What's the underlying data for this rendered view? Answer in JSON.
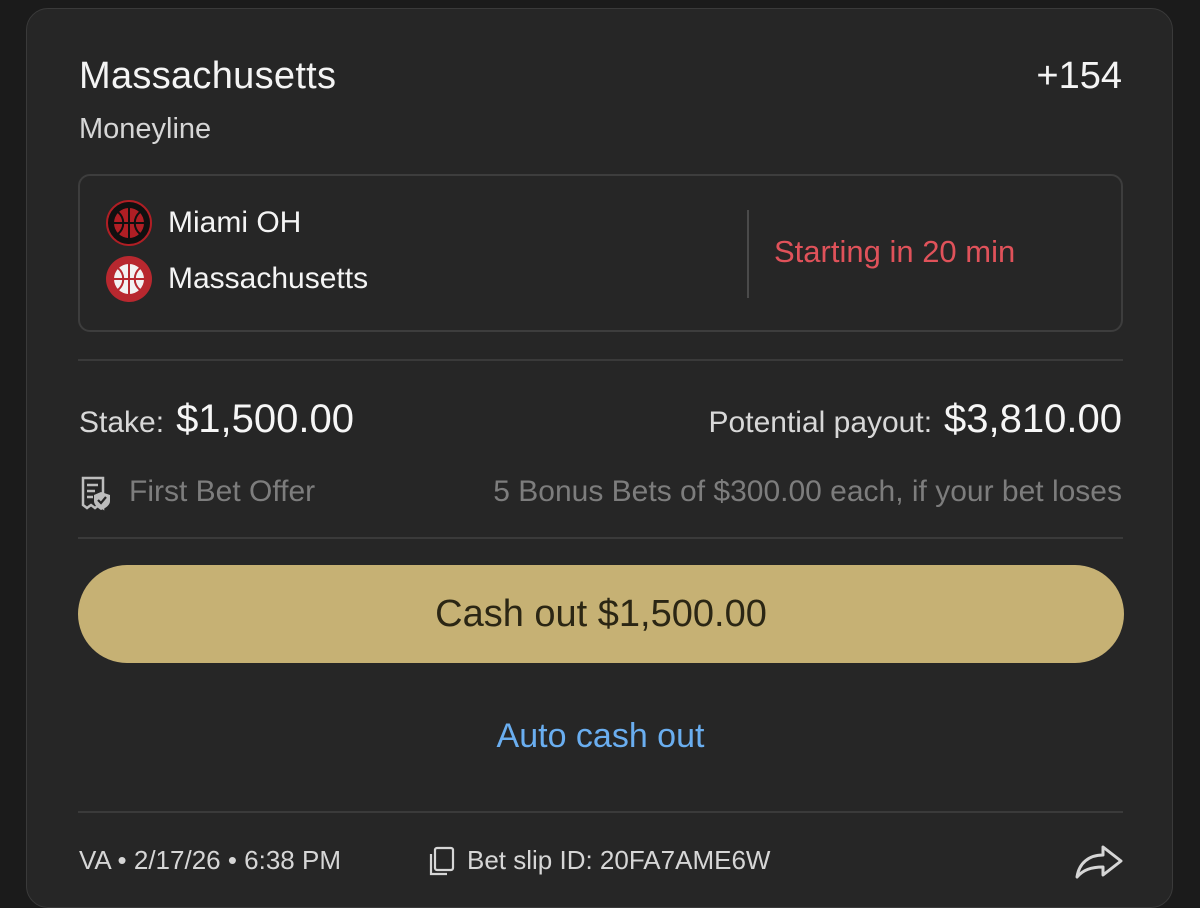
{
  "selection": {
    "team": "Massachusetts",
    "odds": "+154",
    "market": "Moneyline"
  },
  "event": {
    "teams": [
      {
        "name": "Miami OH",
        "logo_icon": "basketball-logo-icon",
        "color": "#b01e24"
      },
      {
        "name": "Massachusetts",
        "logo_icon": "basketball-logo-icon",
        "color": "#b8282f"
      }
    ],
    "status": "Starting in 20 min",
    "status_color": "#e0525a"
  },
  "wager": {
    "stake_label": "Stake:",
    "stake_amount": "$1,500.00",
    "payout_label": "Potential payout:",
    "payout_amount": "$3,810.00"
  },
  "offer": {
    "icon": "receipt-shield-icon",
    "label": "First Bet Offer",
    "description": "5 Bonus Bets of $300.00 each, if your bet loses"
  },
  "actions": {
    "cash_out_label": "Cash out $1,500.00",
    "cash_out_color": "#c6b174",
    "auto_cash_out_label": "Auto cash out",
    "auto_cash_out_color": "#6aaef0"
  },
  "footer": {
    "meta": "VA • 2/17/26 • 6:38 PM",
    "slip_id": "Bet slip ID: 20FA7AME6W",
    "slip_icon": "copy-icon",
    "share_icon": "share-icon"
  }
}
